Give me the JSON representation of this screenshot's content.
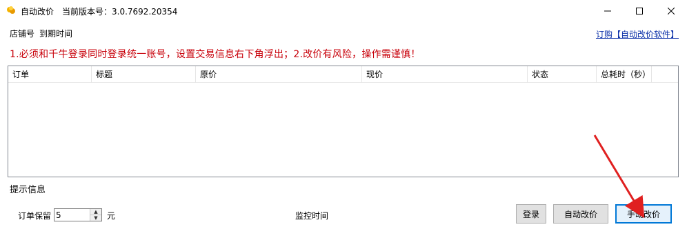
{
  "window": {
    "title": "自动改价　当前版本号：3.0.7692.20354",
    "icon": "app-icon",
    "controls": [
      "minimize-icon",
      "maximize-icon",
      "close-icon"
    ]
  },
  "info": {
    "shop_label": "店铺号",
    "expire_label": "到期时间",
    "buy_link": "订购【自动改价软件】",
    "warning": "1.必须和千牛登录同时登录统一账号，设置交易信息右下角浮出；2.改价有风险，操作需谨慎！"
  },
  "table": {
    "columns": [
      "订单",
      "标题",
      "原价",
      "现价",
      "状态",
      "总耗时（秒）"
    ],
    "rows": []
  },
  "hint": {
    "label": "提示信息"
  },
  "footer": {
    "keep_label": "订单保留",
    "keep_value": "5",
    "unit": "元",
    "monitor_label": "监控时间",
    "login_button": "登录",
    "auto_button": "自动改价",
    "manual_button": "手动改价"
  },
  "colors": {
    "warning": "#c8000a",
    "link": "#0a2fa8",
    "arrow": "#e02020",
    "focus_border": "#0078d7"
  }
}
